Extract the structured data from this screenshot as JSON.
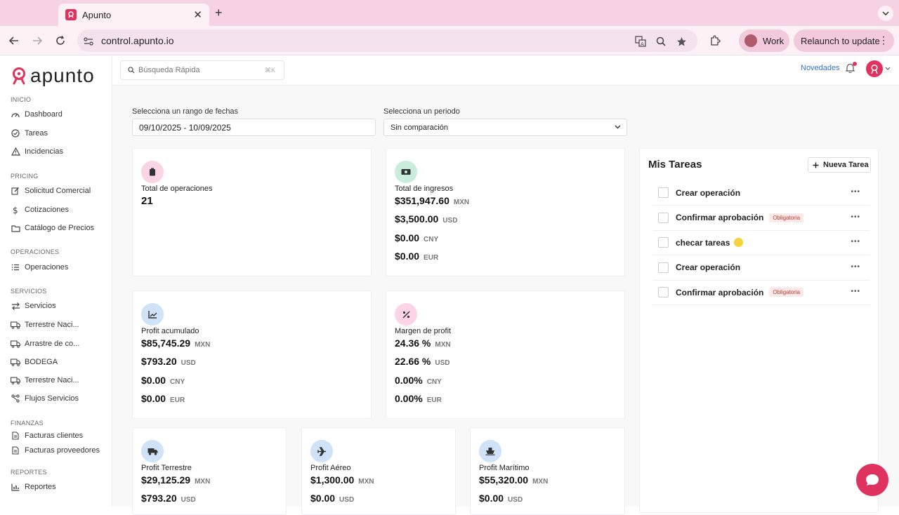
{
  "browser": {
    "tab_title": "Apunto",
    "url": "control.apunto.io",
    "profile": "Work",
    "relaunch": "Relaunch to update"
  },
  "app": {
    "logo": "apunto",
    "search_placeholder": "Búsqueda Rápida",
    "search_shortcut": "⌘K",
    "novedades": "Novedades"
  },
  "sidebar": {
    "sections": [
      {
        "title": "INICIO",
        "items": [
          {
            "label": "Dashboard",
            "icon": "gauge-icon"
          },
          {
            "label": "Tareas",
            "icon": "check-circle-icon"
          },
          {
            "label": "Incidencias",
            "icon": "warning-icon"
          }
        ]
      },
      {
        "title": "PRICING",
        "items": [
          {
            "label": "Solicitud Comercial",
            "icon": "edit-icon"
          },
          {
            "label": "Cotizaciones",
            "icon": "dollar-icon"
          },
          {
            "label": "Catálogo de Precios",
            "icon": "folder-icon"
          }
        ]
      },
      {
        "title": "OPERACIONES",
        "items": [
          {
            "label": "Operaciones",
            "icon": "list-icon"
          }
        ]
      },
      {
        "title": "SERVICIOS",
        "items": [
          {
            "label": "Servicios",
            "icon": "swap-icon"
          },
          {
            "label": "Terrestre Naci...",
            "icon": "truck-icon"
          },
          {
            "label": "Arrastre de co...",
            "icon": "truck-icon"
          },
          {
            "label": "BODEGA",
            "icon": "truck-icon"
          },
          {
            "label": "Terrestre Naci...",
            "icon": "truck-icon"
          },
          {
            "label": "Flujos Servicios",
            "icon": "flow-icon"
          }
        ]
      },
      {
        "title": "FINANZAS",
        "items": [
          {
            "label": "Facturas clientes",
            "icon": "document-icon"
          },
          {
            "label": "Facturas proveedores",
            "icon": "document-icon"
          }
        ]
      },
      {
        "title": "REPORTES",
        "items": [
          {
            "label": "Reportes",
            "icon": "bar-chart-icon"
          }
        ]
      }
    ]
  },
  "filters": {
    "date_label": "Selecciona un rango de fechas",
    "date_value": "09/10/2025 - 10/09/2025",
    "period_label": "Selecciona un periodo",
    "period_value": "Sin comparación"
  },
  "cards": {
    "operaciones": {
      "title": "Total de operaciones",
      "value": "21"
    },
    "ingresos": {
      "title": "Total de ingresos",
      "rows": [
        {
          "v": "$351,947.60",
          "u": "MXN"
        },
        {
          "v": "$3,500.00",
          "u": "USD"
        },
        {
          "v": "$0.00",
          "u": "CNY"
        },
        {
          "v": "$0.00",
          "u": "EUR"
        }
      ]
    },
    "profit": {
      "title": "Profit acumulado",
      "rows": [
        {
          "v": "$85,745.29",
          "u": "MXN"
        },
        {
          "v": "$793.20",
          "u": "USD"
        },
        {
          "v": "$0.00",
          "u": "CNY"
        },
        {
          "v": "$0.00",
          "u": "EUR"
        }
      ]
    },
    "margen": {
      "title": "Margen de profit",
      "rows": [
        {
          "v": "24.36 %",
          "u": "MXN"
        },
        {
          "v": "22.66 %",
          "u": "USD"
        },
        {
          "v": "0.00%",
          "u": "CNY"
        },
        {
          "v": "0.00%",
          "u": "EUR"
        }
      ]
    },
    "terrestre": {
      "title": "Profit Terrestre",
      "rows": [
        {
          "v": "$29,125.29",
          "u": "MXN"
        },
        {
          "v": "$793.20",
          "u": "USD"
        }
      ]
    },
    "aereo": {
      "title": "Profit Aéreo",
      "rows": [
        {
          "v": "$1,300.00",
          "u": "MXN"
        },
        {
          "v": "$0.00",
          "u": "USD"
        }
      ]
    },
    "maritimo": {
      "title": "Profit Marítimo",
      "rows": [
        {
          "v": "$55,320.00",
          "u": "MXN"
        },
        {
          "v": "$0.00",
          "u": "USD"
        }
      ]
    }
  },
  "tasks": {
    "title": "Mis Tareas",
    "new_button": "Nueva Tarea",
    "items": [
      {
        "label": "Crear operación",
        "badge": ""
      },
      {
        "label": "Confirmar aprobación",
        "badge": "Obligatoria"
      },
      {
        "label": "checar tareas",
        "badge": ""
      },
      {
        "label": "Crear operación",
        "badge": ""
      },
      {
        "label": "Confirmar aprobación",
        "badge": "Obligatoria"
      }
    ]
  },
  "colors": {
    "brand": "#e0325e",
    "link": "#3a6fc4"
  }
}
